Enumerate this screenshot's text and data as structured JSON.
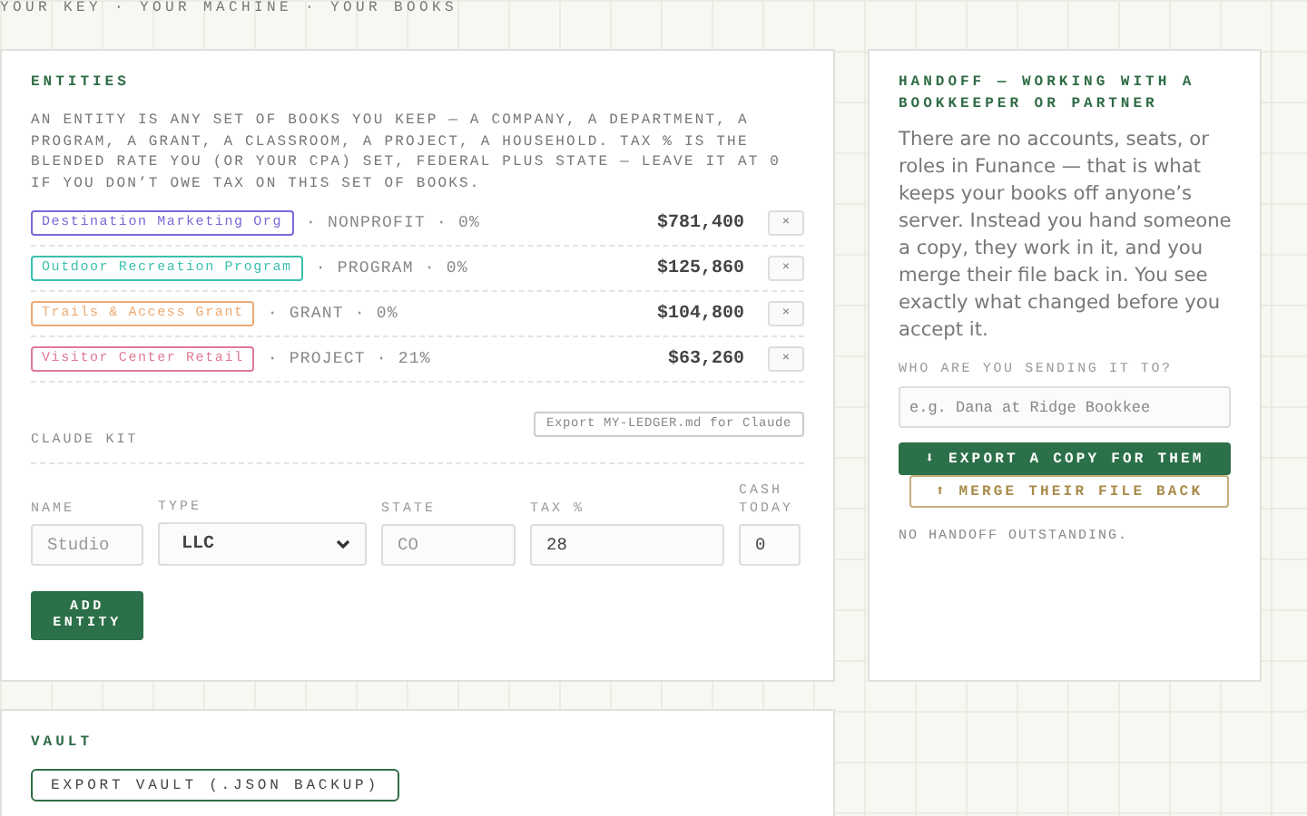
{
  "tagline": "YOUR KEY · YOUR MACHINE · YOUR BOOKS",
  "entities": {
    "title": "ENTITIES",
    "intro": "AN ENTITY IS ANY SET OF BOOKS YOU KEEP — A COMPANY, A DEPARTMENT, A PROGRAM, A GRANT, A CLASSROOM, A PROJECT, A HOUSEHOLD. TAX % IS THE BLENDED RATE YOU (OR YOUR CPA) SET, FEDERAL PLUS STATE — LEAVE IT AT 0 IF YOU DON’T OWE TAX ON THIS SET OF BOOKS.",
    "list": [
      {
        "name": "Destination Marketing Org",
        "color": "#7b68d8",
        "meta": "· NONPROFIT · 0%",
        "amount": "$781,400",
        "remove": "×"
      },
      {
        "name": "Outdoor Recreation Program",
        "color": "#3bbfae",
        "meta": "· PROGRAM · 0%",
        "amount": "$125,860",
        "remove": "×"
      },
      {
        "name": "Trails & Access Grant",
        "color": "#eeaa72",
        "meta": "· GRANT · 0%",
        "amount": "$104,800",
        "remove": "×"
      },
      {
        "name": "Visitor Center Retail",
        "color": "#e07a95",
        "meta": "· PROJECT · 21%",
        "amount": "$63,260",
        "remove": "×"
      }
    ],
    "export_button": "Export MY-LEDGER.md for Claude",
    "kit_label": "CLAUDE KIT",
    "form": [
      {
        "kind": "input",
        "label": "NAME",
        "placeholder": "Studio"
      },
      {
        "kind": "select",
        "label": "TYPE",
        "value": "LLC"
      },
      {
        "kind": "input",
        "label": "STATE",
        "placeholder": "CO"
      },
      {
        "kind": "input",
        "label": "TAX %",
        "value": "28"
      },
      {
        "kind": "input",
        "label": "CASH TODAY",
        "value": "0"
      }
    ],
    "add_button": "ADD ENTITY"
  },
  "handoff": {
    "title": "HANDOFF — WORKING WITH A BOOKKEEPER OR PARTNER",
    "body": "There are no accounts, seats, or roles in Funance — that is what keeps your books off anyone’s server. Instead you hand someone a copy, they work in it, and you merge their file back in. You see exactly what changed before you accept it.",
    "field_label": "WHO ARE YOU SENDING IT TO?",
    "placeholder": "e.g. Dana at Ridge Bookkee",
    "buttons": [
      {
        "kind": "primary",
        "label": "⬇ EXPORT A COPY FOR THEM"
      },
      {
        "kind": "outline",
        "label": "⬆ MERGE THEIR FILE BACK"
      }
    ],
    "status": "NO HANDOFF OUTSTANDING."
  },
  "vault": {
    "title": "VAULT",
    "button": "EXPORT VAULT (.JSON BACKUP)"
  }
}
